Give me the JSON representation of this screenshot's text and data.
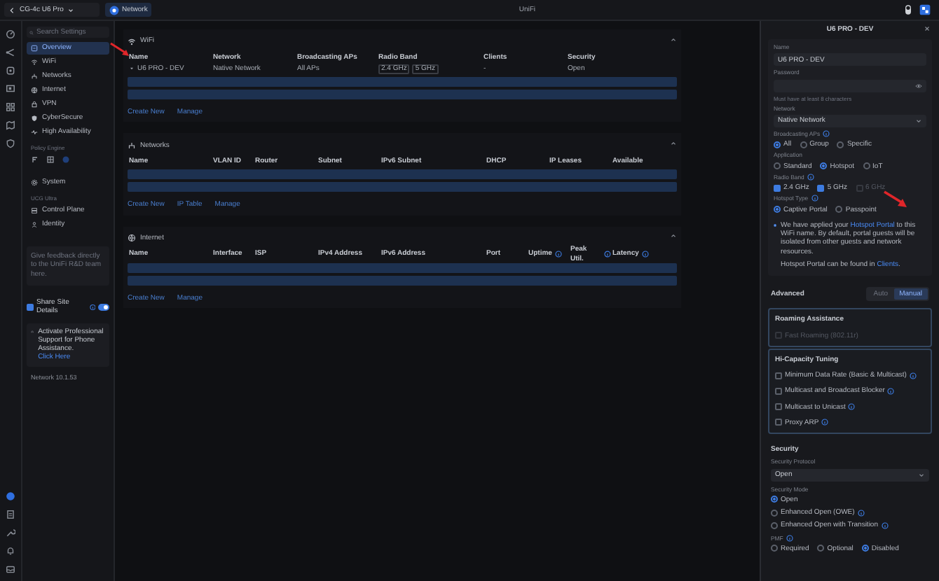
{
  "top_bar": {
    "site": "CG-4c U6 Pro",
    "app": "Network",
    "title": "UniFi"
  },
  "sidebar": {
    "search": {
      "placeholder": "Search Settings"
    },
    "entries": [
      {
        "kind": "item",
        "label": "Overview",
        "selected": true
      },
      {
        "kind": "item",
        "label": "WiFi",
        "selected": false
      },
      {
        "kind": "item",
        "label": "Networks",
        "selected": false
      },
      {
        "kind": "item",
        "label": "Internet",
        "selected": false
      },
      {
        "kind": "item",
        "label": "VPN",
        "selected": false
      },
      {
        "kind": "item",
        "label": "CyberSecure",
        "selected": false
      },
      {
        "kind": "item",
        "label": "High Availability",
        "selected": false
      },
      {
        "kind": "heading",
        "label": "Policy Engine"
      },
      {
        "kind": "icons"
      },
      {
        "kind": "item",
        "label": "System",
        "selected": false
      },
      {
        "kind": "heading",
        "label": "UCG Ultra"
      },
      {
        "kind": "item",
        "label": "Control Plane",
        "selected": false
      },
      {
        "kind": "item",
        "label": "Identity",
        "selected": false
      }
    ],
    "feedback": "Give feedback directly to the UniFi R&D team here.",
    "share": {
      "label": "Share Site Details",
      "checked": true,
      "on": true
    },
    "support": {
      "text": "Activate Professional Support for Phone Assistance.",
      "link": "Click Here"
    },
    "version": "Network 10.1.53"
  },
  "main": {
    "sections": [
      {
        "title": "WiFi",
        "columns": [
          {
            "label": "Name"
          },
          {
            "label": "Network"
          },
          {
            "label": "Broadcasting APs"
          },
          {
            "label": "Radio Band"
          },
          {
            "label": "Clients"
          },
          {
            "label": "Security"
          }
        ],
        "rows": [
          {
            "cells": [
              "U6 PRO - DEV",
              "Native Network",
              "All APs",
              [
                "2.4 GHz",
                "5 GHz"
              ],
              "-",
              "Open"
            ]
          }
        ],
        "actions": [
          "Create New",
          "Manage"
        ]
      },
      {
        "title": "Networks",
        "columns": [
          {
            "label": "Name"
          },
          {
            "label": "VLAN ID"
          },
          {
            "label": "Router"
          },
          {
            "label": "Subnet"
          },
          {
            "label": "IPv6 Subnet"
          },
          {
            "label": "DHCP"
          },
          {
            "label": "IP Leases"
          },
          {
            "label": "Available"
          }
        ],
        "actions": [
          "Create New",
          "IP Table",
          "Manage"
        ]
      },
      {
        "title": "Internet",
        "columns": [
          {
            "label": "Name"
          },
          {
            "label": "Interface"
          },
          {
            "label": "ISP"
          },
          {
            "label": "IPv4 Address"
          },
          {
            "label": "IPv6 Address"
          },
          {
            "label": "Port"
          },
          {
            "label": "Uptime",
            "info": true
          },
          {
            "label": "Peak Util.",
            "info": true
          },
          {
            "label": "Latency",
            "info": true
          }
        ],
        "actions": [
          "Create New",
          "Manage"
        ]
      }
    ]
  },
  "panel": {
    "title": "U6 PRO - DEV",
    "blocks": [
      {
        "kind": "field",
        "label": "Name",
        "value": "U6 PRO - DEV"
      },
      {
        "kind": "password",
        "label": "Password",
        "hint": "Must have at least 8 characters"
      },
      {
        "kind": "select",
        "label": "Network",
        "value": "Native Network"
      },
      {
        "kind": "radios",
        "label": "Broadcasting APs",
        "info": true,
        "options": [
          {
            "label": "All",
            "selected": true
          },
          {
            "label": "Group",
            "selected": false
          },
          {
            "label": "Specific",
            "selected": false
          }
        ]
      },
      {
        "kind": "radios",
        "label": "Application",
        "options": [
          {
            "label": "Standard",
            "selected": false
          },
          {
            "label": "Hotspot",
            "selected": true
          },
          {
            "label": "IoT",
            "selected": false
          }
        ]
      },
      {
        "kind": "checks",
        "label": "Radio Band",
        "info": true,
        "options": [
          {
            "label": "2.4 GHz",
            "checked": true,
            "disabled": false
          },
          {
            "label": "5 GHz",
            "checked": true,
            "disabled": false
          },
          {
            "label": "6 GHz",
            "checked": false,
            "disabled": true
          }
        ]
      },
      {
        "kind": "radios",
        "label": "Hotspot Type",
        "info": true,
        "options": [
          {
            "label": "Captive Portal",
            "selected": true
          },
          {
            "label": "Passpoint",
            "selected": false
          }
        ]
      },
      {
        "kind": "note",
        "lines": [
          {
            "before": "We have applied your ",
            "link": "Hotspot Portal",
            "after": " to this WiFi name. By default, portal guests will be isolated from other guests and network resources."
          },
          {
            "before": "Hotspot Portal can be found in ",
            "link": "Clients",
            "after": "."
          }
        ]
      },
      {
        "kind": "segment",
        "label": "Advanced",
        "options": [
          {
            "label": "Auto",
            "selected": false
          },
          {
            "label": "Manual",
            "selected": true
          }
        ]
      },
      {
        "kind": "card",
        "title": "Roaming Assistance",
        "options": [
          {
            "label": "Fast Roaming (802.11r)",
            "checked": false,
            "disabled": true
          }
        ]
      },
      {
        "kind": "card",
        "title": "Hi-Capacity Tuning",
        "options": [
          {
            "label": "Minimum Data Rate (Basic & Multicast)",
            "checked": false,
            "disabled": false,
            "info": true
          },
          {
            "label": "Multicast and Broadcast Blocker",
            "checked": false,
            "disabled": false,
            "info": true
          },
          {
            "label": "Multicast to Unicast",
            "checked": false,
            "disabled": false,
            "info": true
          },
          {
            "label": "Proxy ARP",
            "checked": false,
            "disabled": false,
            "info": true
          }
        ]
      },
      {
        "kind": "heading",
        "label": "Security"
      },
      {
        "kind": "select",
        "label": "Security Protocol",
        "value": "Open"
      },
      {
        "kind": "radiocol",
        "label": "Security Mode",
        "options": [
          {
            "label": "Open",
            "selected": true
          },
          {
            "label": "Enhanced Open (OWE)",
            "selected": false,
            "info": true
          },
          {
            "label": "Enhanced Open with Transition",
            "selected": false,
            "info": true
          }
        ]
      },
      {
        "kind": "radios",
        "label": "PMF",
        "info": true,
        "options": [
          {
            "label": "Required",
            "selected": false
          },
          {
            "label": "Optional",
            "selected": false
          },
          {
            "label": "Disabled",
            "selected": true
          }
        ]
      }
    ]
  }
}
